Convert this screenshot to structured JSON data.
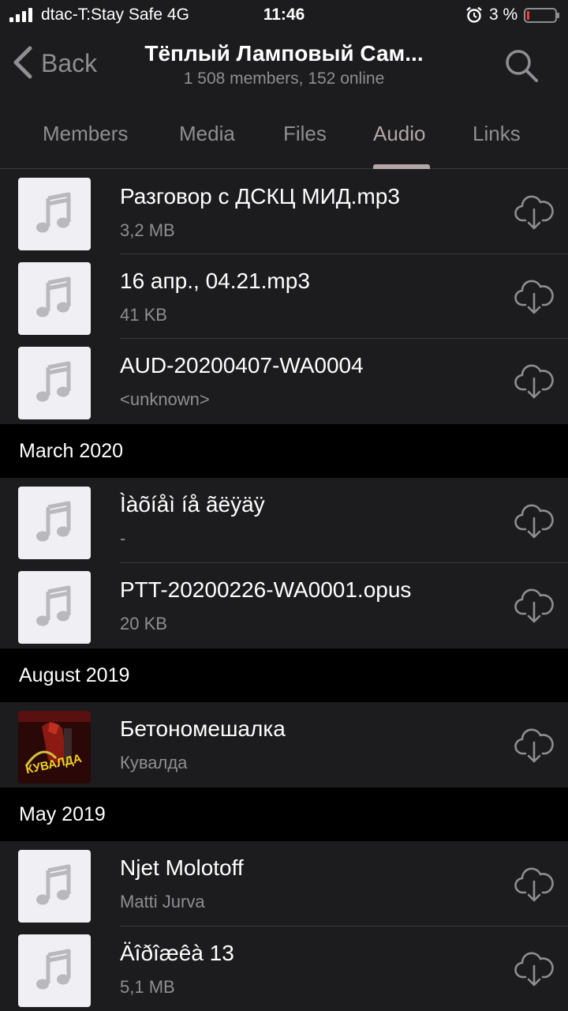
{
  "status_bar": {
    "carrier": "dtac-T:Stay Safe  4G",
    "time": "11:46",
    "battery_percent": "3 %",
    "battery_level": 0.03
  },
  "header": {
    "back_label": "Back",
    "title": "Тёплый Ламповый Сам...",
    "subtitle": "1 508 members, 152 online"
  },
  "tabs": [
    {
      "label": "Members",
      "active": false
    },
    {
      "label": "Media",
      "active": false
    },
    {
      "label": "Files",
      "active": false
    },
    {
      "label": "Audio",
      "active": true
    },
    {
      "label": "Links",
      "active": false
    }
  ],
  "items": [
    {
      "title": "Разговор с ДСКЦ МИД.mp3",
      "subtitle": "3,2 MB"
    },
    {
      "title": "16 апр., 04.21.mp3",
      "subtitle": "41 KB"
    },
    {
      "title": "AUD-20200407-WA0004",
      "subtitle": "<unknown>"
    },
    {
      "title": "Ìàõíåì íå ãëÿäÿ",
      "subtitle": "-"
    },
    {
      "title": "PTT-20200226-WA0001.opus",
      "subtitle": "20 KB"
    },
    {
      "title": "Бетономешалка",
      "subtitle": "Кувалда"
    },
    {
      "title": "Njet Molotoff",
      "subtitle": "Matti Jurva"
    },
    {
      "title": "Äîðîæêà 13",
      "subtitle": "5,1 MB"
    }
  ],
  "sections": [
    {
      "label": "March 2020"
    },
    {
      "label": "August 2019"
    },
    {
      "label": "May 2019"
    }
  ],
  "cover_art_text": "КУВАЛДА",
  "colors": {
    "background": "#1c1c1e",
    "section_background": "#000000",
    "accent_tab": "#b3a6a6",
    "secondary_text": "#8e8e93",
    "battery_low": "#ff3b30"
  },
  "icons": {
    "back": "chevron-left-icon",
    "search": "search-icon",
    "download": "cloud-download-icon",
    "audio_placeholder": "music-note-icon"
  }
}
